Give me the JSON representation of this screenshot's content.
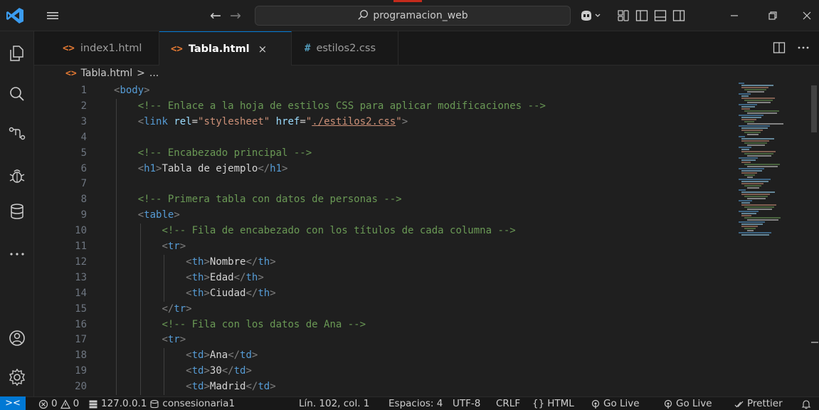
{
  "titlebar": {
    "search_text": "programacion_web"
  },
  "tabs": [
    {
      "label": "index1.html",
      "icon": "<>",
      "type": "html"
    },
    {
      "label": "Tabla.html",
      "icon": "<>",
      "type": "html",
      "active": true
    },
    {
      "label": "estilos2.css",
      "icon": "#",
      "type": "css"
    }
  ],
  "tab_close": "×",
  "breadcrumb": {
    "file": "Tabla.html",
    "sep": ">",
    "rest": "..."
  },
  "lines": [
    {
      "n": "1",
      "indent": 0,
      "tokens": [
        [
          "t-bracket",
          "<"
        ],
        [
          "t-tag",
          "body"
        ],
        [
          "t-bracket",
          ">"
        ]
      ]
    },
    {
      "n": "2",
      "indent": 1,
      "tokens": [
        [
          "t-comment",
          "<!-- Enlace a la hoja de estilos CSS para aplicar modificaciones -->"
        ]
      ]
    },
    {
      "n": "3",
      "indent": 1,
      "tokens": [
        [
          "t-bracket",
          "<"
        ],
        [
          "t-tag",
          "link"
        ],
        [
          "t-text",
          " "
        ],
        [
          "t-attr",
          "rel"
        ],
        [
          "t-text",
          "="
        ],
        [
          "t-str",
          "\"stylesheet\""
        ],
        [
          "t-text",
          " "
        ],
        [
          "t-attr",
          "href"
        ],
        [
          "t-text",
          "="
        ],
        [
          "t-str",
          "\""
        ],
        [
          "t-link",
          "./estilos2.css"
        ],
        [
          "t-str",
          "\""
        ],
        [
          "t-bracket",
          ">"
        ]
      ]
    },
    {
      "n": "4",
      "indent": 1,
      "tokens": []
    },
    {
      "n": "5",
      "indent": 1,
      "tokens": [
        [
          "t-comment",
          "<!-- Encabezado principal -->"
        ]
      ]
    },
    {
      "n": "6",
      "indent": 1,
      "tokens": [
        [
          "t-bracket",
          "<"
        ],
        [
          "t-tag",
          "h1"
        ],
        [
          "t-bracket",
          ">"
        ],
        [
          "t-text",
          "Tabla de ejemplo"
        ],
        [
          "t-bracket",
          "</"
        ],
        [
          "t-tag",
          "h1"
        ],
        [
          "t-bracket",
          ">"
        ]
      ]
    },
    {
      "n": "7",
      "indent": 1,
      "tokens": []
    },
    {
      "n": "8",
      "indent": 1,
      "tokens": [
        [
          "t-comment",
          "<!-- Primera tabla con datos de personas -->"
        ]
      ]
    },
    {
      "n": "9",
      "indent": 1,
      "tokens": [
        [
          "t-bracket",
          "<"
        ],
        [
          "t-tag",
          "table"
        ],
        [
          "t-bracket",
          ">"
        ]
      ]
    },
    {
      "n": "10",
      "indent": 2,
      "tokens": [
        [
          "t-comment",
          "<!-- Fila de encabezado con los títulos de cada columna -->"
        ]
      ]
    },
    {
      "n": "11",
      "indent": 2,
      "tokens": [
        [
          "t-bracket",
          "<"
        ],
        [
          "t-tag",
          "tr"
        ],
        [
          "t-bracket",
          ">"
        ]
      ]
    },
    {
      "n": "12",
      "indent": 3,
      "tokens": [
        [
          "t-bracket",
          "<"
        ],
        [
          "t-tag",
          "th"
        ],
        [
          "t-bracket",
          ">"
        ],
        [
          "t-text",
          "Nombre"
        ],
        [
          "t-bracket",
          "</"
        ],
        [
          "t-tag",
          "th"
        ],
        [
          "t-bracket",
          ">"
        ]
      ]
    },
    {
      "n": "13",
      "indent": 3,
      "tokens": [
        [
          "t-bracket",
          "<"
        ],
        [
          "t-tag",
          "th"
        ],
        [
          "t-bracket",
          ">"
        ],
        [
          "t-text",
          "Edad"
        ],
        [
          "t-bracket",
          "</"
        ],
        [
          "t-tag",
          "th"
        ],
        [
          "t-bracket",
          ">"
        ]
      ]
    },
    {
      "n": "14",
      "indent": 3,
      "tokens": [
        [
          "t-bracket",
          "<"
        ],
        [
          "t-tag",
          "th"
        ],
        [
          "t-bracket",
          ">"
        ],
        [
          "t-text",
          "Ciudad"
        ],
        [
          "t-bracket",
          "</"
        ],
        [
          "t-tag",
          "th"
        ],
        [
          "t-bracket",
          ">"
        ]
      ]
    },
    {
      "n": "15",
      "indent": 2,
      "tokens": [
        [
          "t-bracket",
          "</"
        ],
        [
          "t-tag",
          "tr"
        ],
        [
          "t-bracket",
          ">"
        ]
      ]
    },
    {
      "n": "16",
      "indent": 2,
      "tokens": [
        [
          "t-comment",
          "<!-- Fila con los datos de Ana -->"
        ]
      ]
    },
    {
      "n": "17",
      "indent": 2,
      "tokens": [
        [
          "t-bracket",
          "<"
        ],
        [
          "t-tag",
          "tr"
        ],
        [
          "t-bracket",
          ">"
        ]
      ]
    },
    {
      "n": "18",
      "indent": 3,
      "tokens": [
        [
          "t-bracket",
          "<"
        ],
        [
          "t-tag",
          "td"
        ],
        [
          "t-bracket",
          ">"
        ],
        [
          "t-text",
          "Ana"
        ],
        [
          "t-bracket",
          "</"
        ],
        [
          "t-tag",
          "td"
        ],
        [
          "t-bracket",
          ">"
        ]
      ]
    },
    {
      "n": "19",
      "indent": 3,
      "tokens": [
        [
          "t-bracket",
          "<"
        ],
        [
          "t-tag",
          "td"
        ],
        [
          "t-bracket",
          ">"
        ],
        [
          "t-text",
          "30"
        ],
        [
          "t-bracket",
          "</"
        ],
        [
          "t-tag",
          "td"
        ],
        [
          "t-bracket",
          ">"
        ]
      ]
    },
    {
      "n": "20",
      "indent": 3,
      "tokens": [
        [
          "t-bracket",
          "<"
        ],
        [
          "t-tag",
          "td"
        ],
        [
          "t-bracket",
          ">"
        ],
        [
          "t-text",
          "Madrid"
        ],
        [
          "t-bracket",
          "</"
        ],
        [
          "t-tag",
          "td"
        ],
        [
          "t-bracket",
          ">"
        ]
      ]
    }
  ],
  "statusbar": {
    "remote": "><",
    "errors": "0",
    "warnings": "0",
    "server": "127.0.0.1",
    "database": "consesionaria1",
    "position": "Lín. 102, col. 1",
    "spaces": "Espacios: 4",
    "encoding": "UTF-8",
    "eol": "CRLF",
    "language_braces": "{}",
    "language": "HTML",
    "golive1": "Go Live",
    "golive2": "Go Live",
    "prettier": "Prettier"
  },
  "colors": {
    "accent": "#0078d4",
    "html_icon": "#e37933",
    "css_icon": "#519aba"
  }
}
